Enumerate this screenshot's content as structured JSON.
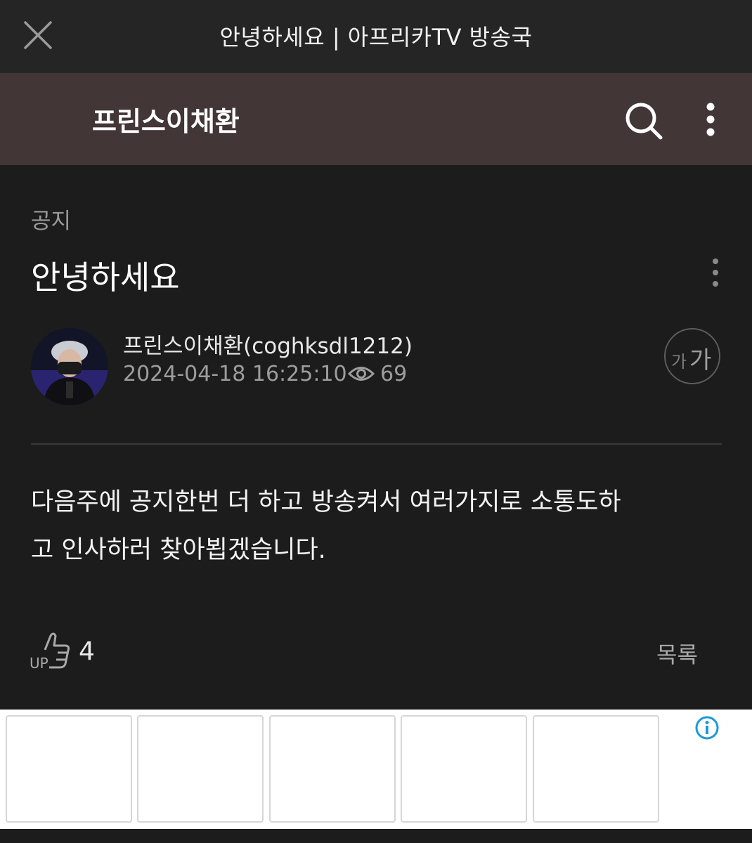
{
  "window": {
    "title": "안녕하세요 | 아프리카TV 방송국"
  },
  "channel": {
    "name": "프린스이채환"
  },
  "post": {
    "category": "공지",
    "title": "안녕하세요",
    "author": "프린스이채환(coghksdl1212)",
    "datetime": "2024-04-18 16:25:10",
    "views": "69",
    "font_size_small": "가",
    "font_size_big": "가",
    "body_line1": "다음주에 공지한번 더 하고 방송켜서 여러가지로 소통도하",
    "body_line2": "고 인사하러 찾아뵙겠습니다.",
    "like_label": "UP",
    "likes": "4",
    "list_label": "목록"
  },
  "icons": {
    "close": "close-icon",
    "back": "arrow-left-icon",
    "search": "search-icon",
    "more": "more-vertical-icon",
    "eye": "eye-icon",
    "like": "thumbs-up-icon",
    "info": "info-icon"
  },
  "colors": {
    "topbar": "#252525",
    "channel_header": "#433637",
    "background": "#1c1c1c",
    "info_icon": "#1a9ad6"
  }
}
